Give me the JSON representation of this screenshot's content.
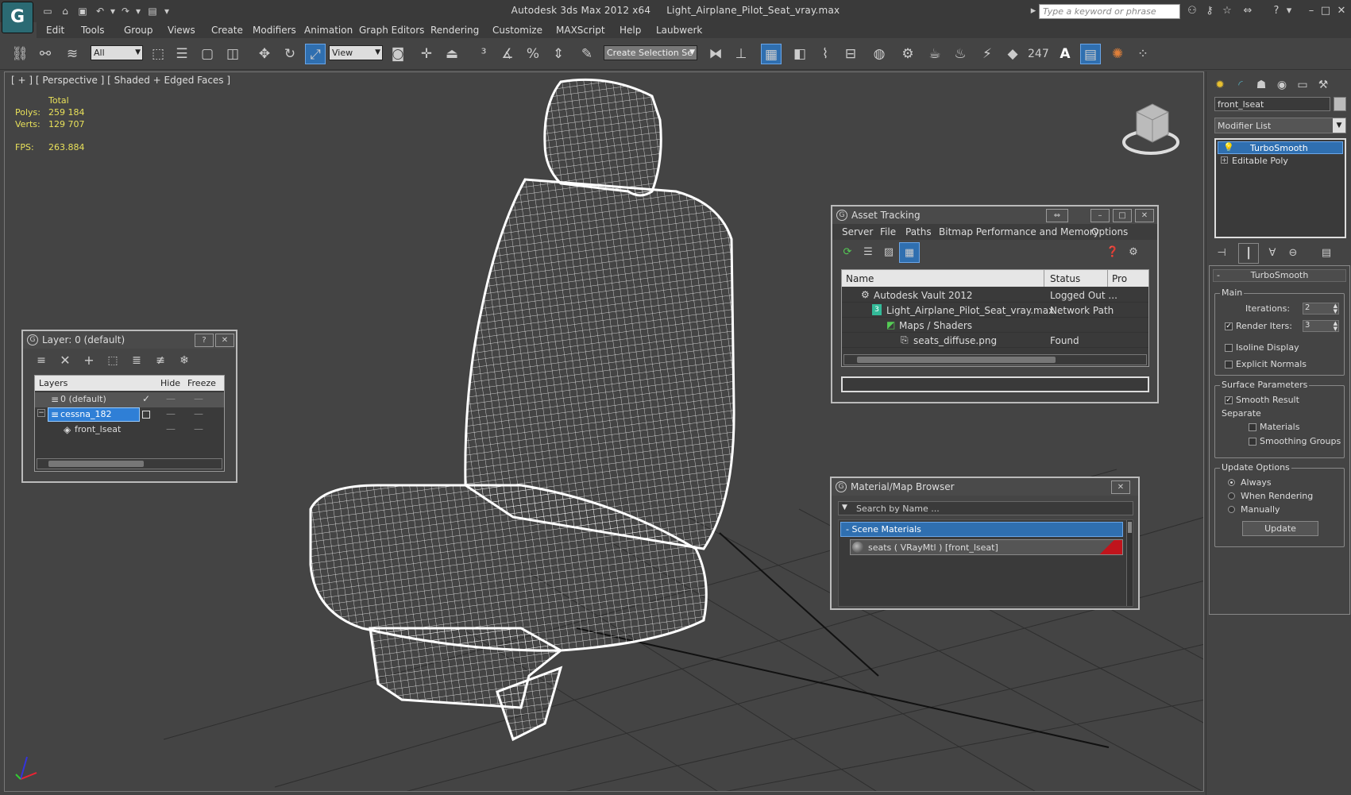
{
  "app": {
    "title": "Autodesk 3ds Max  2012 x64",
    "filename": "Light_Airplane_Pilot_Seat_vray.max",
    "logo": "G",
    "search_placeholder": "Type a keyword or phrase"
  },
  "menu": [
    "Edit",
    "Tools",
    "Group",
    "Views",
    "Create",
    "Modifiers",
    "Animation",
    "Graph Editors",
    "Rendering",
    "Customize",
    "MAXScript",
    "Help",
    "Laubwerk"
  ],
  "toolbar": {
    "selection_filter": "All",
    "ref_coord": "View",
    "selection_set": "Create Selection Se",
    "snap_counter": "247"
  },
  "viewport": {
    "label": "[ + ] [ Perspective ] [ Shaded + Edged Faces ]",
    "stats": {
      "total_label": "Total",
      "polys_label": "Polys:",
      "polys": "259 184",
      "verts_label": "Verts:",
      "verts": "129 707",
      "fps_label": "FPS:",
      "fps": "263.884"
    }
  },
  "layer_panel": {
    "title": "Layer: 0 (default)",
    "columns": [
      "Layers",
      "Hide",
      "Freeze"
    ],
    "rows": [
      {
        "name": "0 (default)",
        "current": true
      },
      {
        "name": "cessna_182",
        "selected": true
      },
      {
        "name": "front_lseat"
      }
    ]
  },
  "asset_tracking": {
    "title": "Asset Tracking",
    "menu": [
      "Server",
      "File",
      "Paths",
      "Bitmap Performance and Memory",
      "Options"
    ],
    "columns": [
      "Name",
      "Status",
      "Pro"
    ],
    "rows": [
      {
        "name": "Autodesk Vault 2012",
        "status": "Logged Out ..."
      },
      {
        "name": "Light_Airplane_Pilot_Seat_vray.max",
        "status": "Network Path"
      },
      {
        "name": "Maps / Shaders",
        "status": ""
      },
      {
        "name": "seats_diffuse.png",
        "status": "Found"
      }
    ]
  },
  "material_browser": {
    "title": "Material/Map Browser",
    "search_placeholder": "Search by Name ...",
    "group": "- Scene Materials",
    "item": "seats  ( VRayMtl )  [front_lseat]"
  },
  "command_panel": {
    "object_name": "front_lseat",
    "modifier_list": "Modifier List",
    "stack": [
      "TurboSmooth",
      "Editable Poly"
    ],
    "rollout": "TurboSmooth",
    "main_label": "Main",
    "iterations_label": "Iterations:",
    "iterations": "2",
    "render_iters_label": "Render Iters:",
    "render_iters": "3",
    "isoline": "Isoline Display",
    "explicit_normals": "Explicit Normals",
    "surface_params": "Surface Parameters",
    "smooth_result": "Smooth Result",
    "separate": "Separate",
    "materials": "Materials",
    "smoothing_groups": "Smoothing Groups",
    "update_options": "Update Options",
    "always": "Always",
    "when_rendering": "When Rendering",
    "manually": "Manually",
    "update_button": "Update"
  },
  "colors": {
    "accent": "#2f7fd6",
    "stats_yellow": "#e8e05a",
    "material_swatch": "#c0141c"
  }
}
